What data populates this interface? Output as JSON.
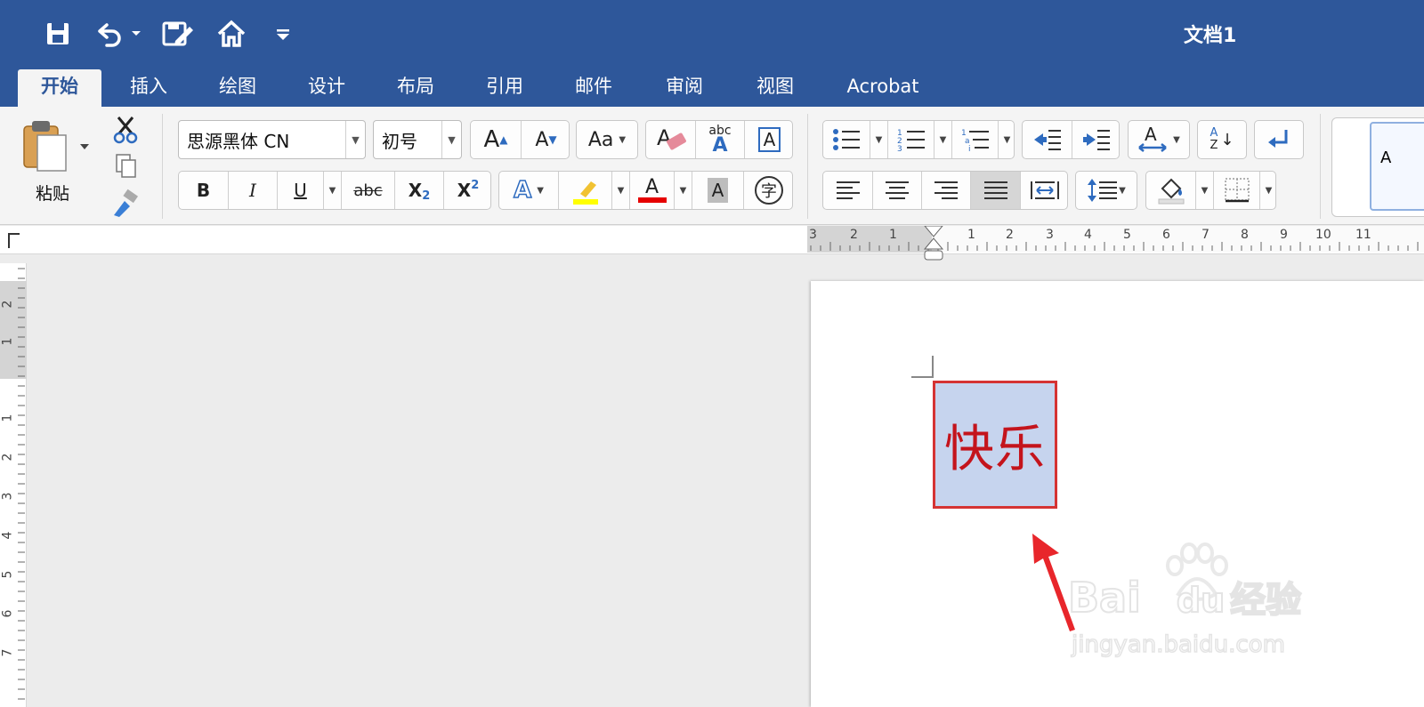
{
  "app": {
    "title": "文档1"
  },
  "quick_access": {
    "icons": [
      "save-icon",
      "undo-icon",
      "edit-document-icon",
      "home-icon",
      "customize-icon"
    ]
  },
  "tabs": [
    {
      "label": "开始",
      "active": true
    },
    {
      "label": "插入"
    },
    {
      "label": "绘图"
    },
    {
      "label": "设计"
    },
    {
      "label": "布局"
    },
    {
      "label": "引用"
    },
    {
      "label": "邮件"
    },
    {
      "label": "审阅"
    },
    {
      "label": "视图"
    },
    {
      "label": "Acrobat"
    }
  ],
  "ribbon": {
    "paste_label": "粘贴",
    "font_name": "思源黑体 CN",
    "font_size": "初号",
    "format_buttons": {
      "bold": "B",
      "italic": "I",
      "underline": "U",
      "strike": "abc",
      "subscript": "X",
      "subscript_mark": "2",
      "superscript": "X",
      "superscript_mark": "2"
    },
    "grow_font": "A",
    "shrink_font": "A",
    "change_case": "Aa",
    "phonetic_text": "abc",
    "phonetic_letter": "A",
    "char_border": "A",
    "text_effects": "A",
    "font_color": "A",
    "char_shading": "A",
    "enclose_char": "字",
    "sort_az_top": "A",
    "sort_az_bottom": "Z",
    "style_preview": "A",
    "colors": {
      "highlight": "#ffff00",
      "font_color": "#e60000",
      "accent": "#2e579a"
    }
  },
  "ruler": {
    "h_left": [
      "3",
      "2",
      "1"
    ],
    "h_right": [
      "1",
      "2",
      "3",
      "4",
      "5",
      "6",
      "7",
      "8",
      "9",
      "10",
      "11"
    ],
    "v_top": [
      "2",
      "1"
    ],
    "v_bottom": [
      "1",
      "2",
      "3",
      "4",
      "5",
      "6",
      "7"
    ]
  },
  "document": {
    "selected_text": "快乐"
  },
  "watermark": {
    "brand_letters": "Bai",
    "brand_suffix": "du",
    "service": "经验",
    "url": "jingyan.baidu.com"
  }
}
